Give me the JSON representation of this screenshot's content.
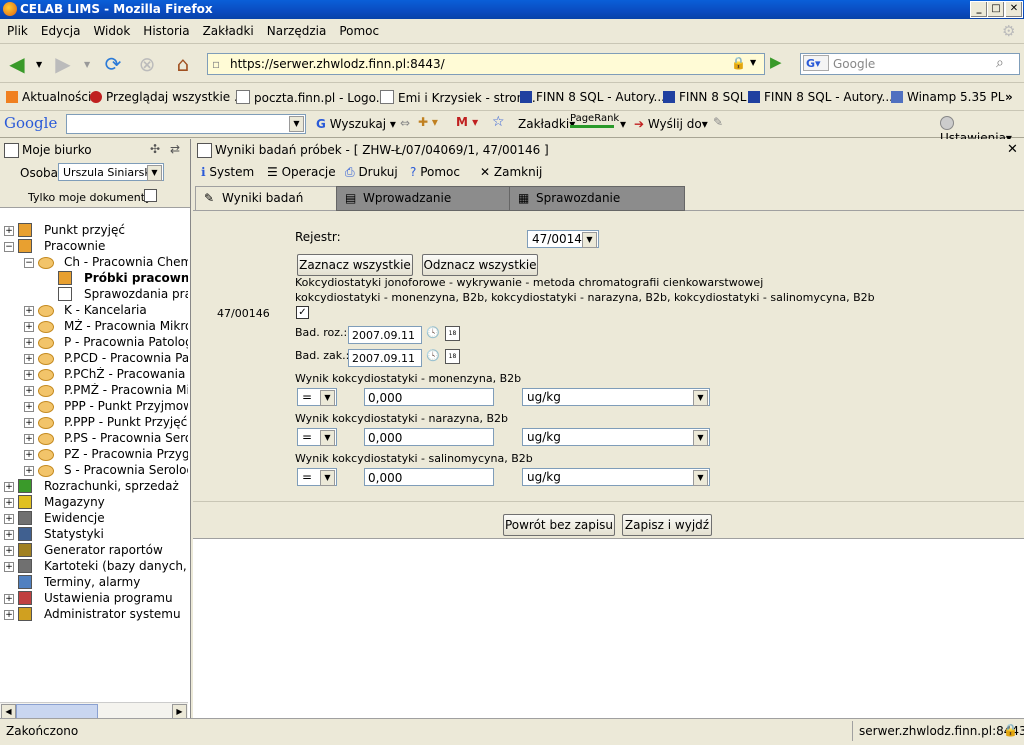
{
  "window": {
    "title": "CELAB LIMS - Mozilla Firefox"
  },
  "menu": [
    "Plik",
    "Edycja",
    "Widok",
    "Historia",
    "Zakładki",
    "Narzędzia",
    "Pomoc"
  ],
  "nav": {
    "url": "https://serwer.zhwlodz.finn.pl:8443/",
    "search_placeholder": "Google"
  },
  "bookmarks": [
    "Aktualności",
    "Przeglądaj wszystkie ...",
    "poczta.finn.pl - Logo...",
    "Emi i Krzysiek - stron...",
    "FINN 8 SQL - Autory...",
    "FINN 8 SQL",
    "FINN 8 SQL - Autory...",
    "Winamp 5.35 PL"
  ],
  "gbar": {
    "logo": "Google",
    "search": "Wyszukaj",
    "zakladki": "Zakładki",
    "pagerank": "PageRank",
    "wyslij": "Wyślij do",
    "ustawienia": "Ustawienia"
  },
  "sidebar": {
    "title": "Moje biurko",
    "osoba_label": "Osoba:",
    "osoba_value": "Urszula Siniarska",
    "only_mine": "Tylko moje dokumenty:",
    "tree": [
      "Punkt przyjęć",
      "Pracownie",
      "Ch - Pracownia Chemi",
      "Próbki pracowni",
      "Sprawozdania prac",
      "K - Kancelaria",
      "MŻ - Pracownia Mikrob",
      "P - Pracownia Patologi",
      "P.PCD - Pracownia Pa",
      "P.PChŻ - Pracowania C",
      "P.PMŻ - Pracownia Mik",
      "PPP - Punkt Przyjmowa",
      "P.PPP - Punkt Przyjęć F",
      "P.PS - Pracownia Sero",
      "PZ - Pracownia Przygot",
      "S - Pracownia Serolog",
      "Rozrachunki, sprzedaż",
      "Magazyny",
      "Ewidencje",
      "Statystyki",
      "Generator raportów",
      "Kartoteki (bazy danych, zbi",
      "Terminy, alarmy",
      "Ustawienia programu",
      "Administrator systemu"
    ]
  },
  "main": {
    "title": "Wyniki badań próbek - [ ZHW-Ł/07/04069/1, 47/00146 ]",
    "toolbar": [
      "System",
      "Operacje",
      "Drukuj",
      "Pomoc",
      "Zamknij"
    ],
    "tabs": [
      "Wyniki badań próbek",
      "Wprowadzanie zakresowe",
      "Sprawozdanie częściowe"
    ],
    "rejestr_label": "Rejestr:",
    "rejestr_value": "47/00146",
    "select_all": "Zaznacz wszystkie",
    "deselect_all": "Odznacz wszystkie",
    "sample_id": "47/00146",
    "method_line1": "Kokcydiostatyki jonoforowe - wykrywanie - metoda chromatografii cienkowarstwowej",
    "method_line2": "kokcydiostatyki - monenzyna, B2b, kokcydiostatyki - narazyna, B2b, kokcydiostatyki - salinomycyna, B2b",
    "bad_roz_label": "Bad. roz.:",
    "bad_roz_value": "2007.09.11",
    "bad_zak_label": "Bad. zak.:",
    "bad_zak_value": "2007.09.11",
    "results": [
      {
        "label": "Wynik kokcydiostatyki - monenzyna, B2b",
        "op": "=",
        "value": "0,000",
        "unit": "ug/kg"
      },
      {
        "label": "Wynik kokcydiostatyki - narazyna, B2b",
        "op": "=",
        "value": "0,000",
        "unit": "ug/kg"
      },
      {
        "label": "Wynik kokcydiostatyki - salinomycyna, B2b",
        "op": "=",
        "value": "0,000",
        "unit": "ug/kg"
      }
    ],
    "btn_back": "Powrót bez zapisu",
    "btn_save": "Zapisz i wyjdź",
    "cal_day": "18"
  },
  "status": {
    "left": "Zakończono",
    "right": "serwer.zhwlodz.finn.pl:8443"
  }
}
